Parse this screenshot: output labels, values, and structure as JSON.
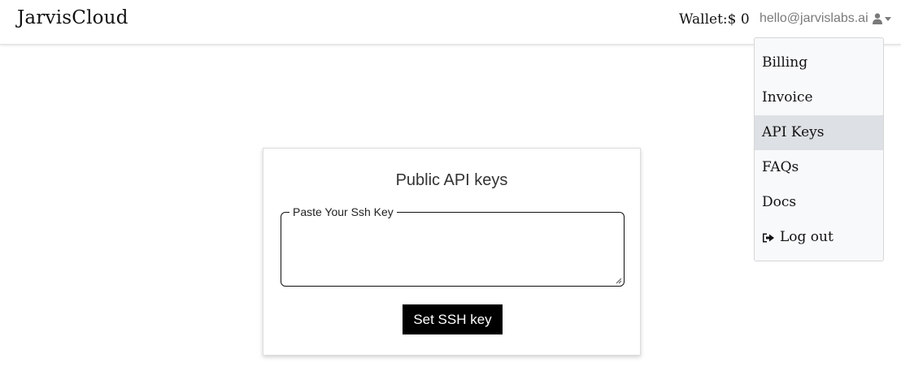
{
  "brand": "JarvisCloud",
  "wallet": "Wallet:$ 0",
  "user": {
    "email": "hello@jarvislabs.ai",
    "icon": "user-icon"
  },
  "menu": {
    "items": [
      {
        "label": "Billing"
      },
      {
        "label": "Invoice"
      },
      {
        "label": "API Keys",
        "active": true
      },
      {
        "label": "FAQs"
      },
      {
        "label": "Docs"
      },
      {
        "label": "Log out",
        "icon": "sign-out-icon"
      }
    ]
  },
  "card": {
    "title": "Public API keys",
    "ssh_label": "Paste Your Ssh Key",
    "ssh_value": "",
    "button_label": "Set SSH key"
  }
}
